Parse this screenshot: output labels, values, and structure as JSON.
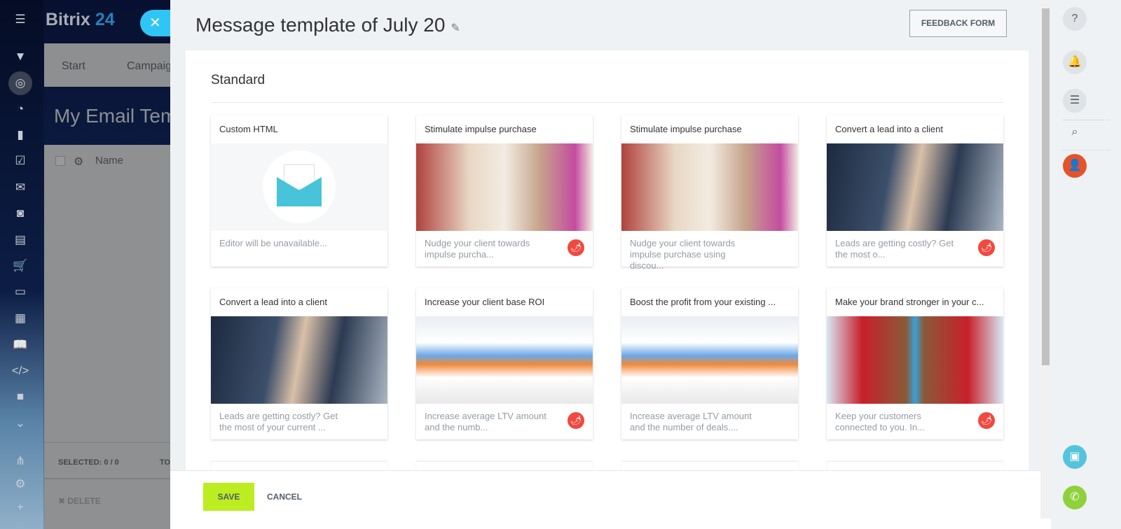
{
  "app": {
    "logo_text": "Bitrix",
    "logo_num": "24"
  },
  "background": {
    "tabs": [
      "Start",
      "Campaig"
    ],
    "title": "My Email Tem",
    "grid_col": "Name",
    "selected": "SELECTED: 0 / 0",
    "total_cut": "TO",
    "delete": "DELETE"
  },
  "slider": {
    "title": "Message template of July 20",
    "feedback": "FEEDBACK FORM",
    "section": "Standard",
    "cards": [
      {
        "title": "Custom HTML",
        "desc": "Editor will be unavailable...",
        "image": "email-envelope",
        "badge": false
      },
      {
        "title": "Stimulate impulse purchase",
        "desc": "Nudge your client towards impulse purcha...",
        "image": "shopping-couple",
        "badge": true
      },
      {
        "title": "Stimulate impulse purchase",
        "desc": "Nudge your client towards impulse purchase using discou...",
        "image": "shopping-couple",
        "badge": false
      },
      {
        "title": "Convert a lead into a client",
        "desc": "Leads are getting costly? Get the most o...",
        "image": "handshake",
        "badge": true
      },
      {
        "title": "Convert a lead into a client",
        "desc": "Leads are getting costly? Get the most of your current ...",
        "image": "handshake",
        "badge": false
      },
      {
        "title": "Increase your client base ROI",
        "desc": "Increase average LTV amount and the numb...",
        "image": "chart-report",
        "badge": true
      },
      {
        "title": "Boost the profit from your existing ...",
        "desc": "Increase average LTV amount and the number of deals....",
        "image": "chart-report",
        "badge": false
      },
      {
        "title": "Make your brand stronger in your c...",
        "desc": "Keep your customers connected to you. In...",
        "image": "superhero-kid",
        "badge": true
      }
    ],
    "save": "SAVE",
    "cancel": "CANCEL"
  },
  "colors": {
    "accent": "#2fc6f6",
    "save": "#bbed21",
    "badge": "#f0493f",
    "avatar": "#e5532a"
  }
}
